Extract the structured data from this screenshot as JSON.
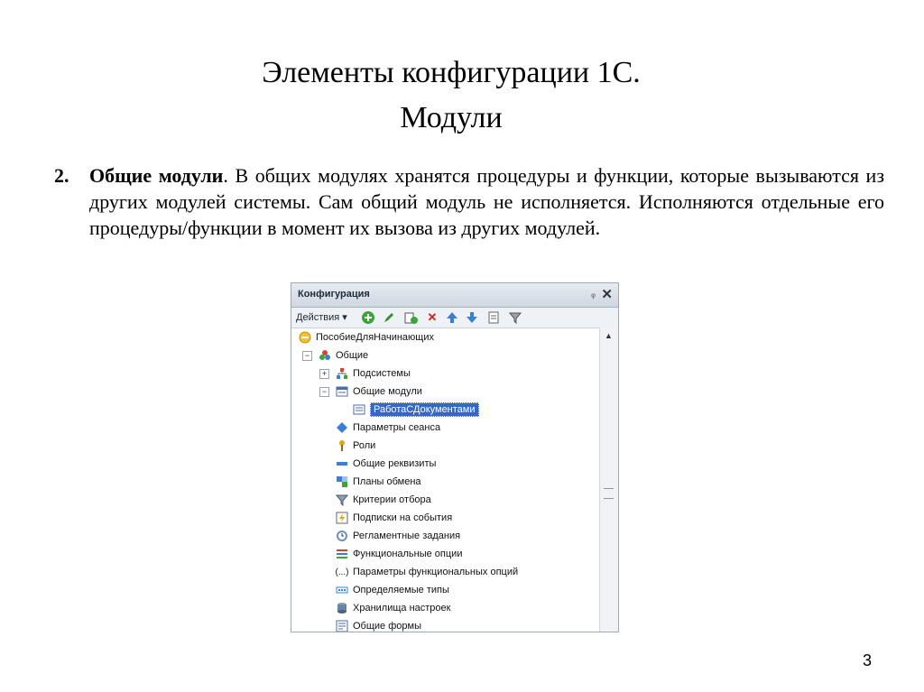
{
  "slide": {
    "title_line1": "Элементы конфигурации 1С.",
    "title_line2": "Модули",
    "item_number": "2.",
    "item_bold": "Общие модули",
    "item_text": ". В общих модулях хранятся процедуры и функции, которые вызываются из других модулей системы. Сам общий модуль не исполняется. Исполняются отдельные его процедуры/функции в момент их вызова из других модулей.",
    "page_number": "3"
  },
  "panel": {
    "title": "Конфигурация",
    "pin": "ᵩ",
    "close": "✕",
    "actions_label": "Действия ▾",
    "toolbar_icons": [
      "add-icon",
      "edit-icon",
      "add-copy-icon",
      "delete-icon",
      "move-up-icon",
      "move-down-icon",
      "sort-icon",
      "filter-icon"
    ],
    "tree": [
      {
        "label": "ПособиеДляНачинающих",
        "icon": "config-root-icon"
      },
      {
        "label": "Общие",
        "icon": "common-icon"
      },
      {
        "label": "Подсистемы",
        "icon": "subsystems-icon"
      },
      {
        "label": "Общие модули",
        "icon": "common-modules-icon"
      },
      {
        "label": "РаботаСДокументами",
        "icon": "module-icon",
        "selected": true
      },
      {
        "label": "Параметры сеанса",
        "icon": "session-params-icon"
      },
      {
        "label": "Роли",
        "icon": "roles-icon"
      },
      {
        "label": "Общие реквизиты",
        "icon": "common-attributes-icon"
      },
      {
        "label": "Планы обмена",
        "icon": "exchange-plans-icon"
      },
      {
        "label": "Критерии отбора",
        "icon": "filter-criteria-icon"
      },
      {
        "label": "Подписки на события",
        "icon": "event-subscriptions-icon"
      },
      {
        "label": "Регламентные задания",
        "icon": "scheduled-jobs-icon"
      },
      {
        "label": "Функциональные опции",
        "icon": "functional-options-icon"
      },
      {
        "label": "Параметры функциональных опций",
        "icon": "functional-option-params-icon"
      },
      {
        "label": "Определяемые типы",
        "icon": "defined-types-icon"
      },
      {
        "label": "Хранилища настроек",
        "icon": "settings-storage-icon"
      },
      {
        "label": "Общие формы",
        "icon": "common-forms-icon"
      }
    ]
  }
}
